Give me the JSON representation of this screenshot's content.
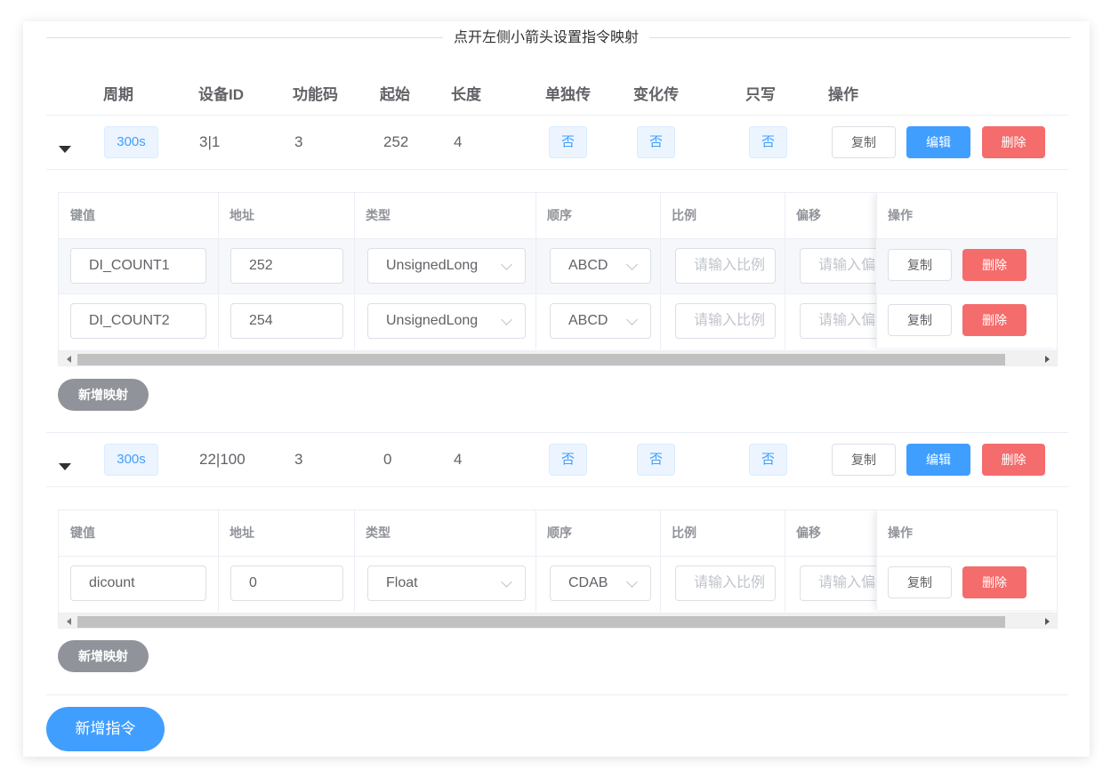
{
  "title": "点开左侧小箭头设置指令映射",
  "headers": [
    "周期",
    "设备ID",
    "功能码",
    "起始",
    "长度",
    "单独传",
    "变化传",
    "只写",
    "操作"
  ],
  "sub_headers": [
    "键值",
    "地址",
    "类型",
    "顺序",
    "比例",
    "偏移",
    "操作"
  ],
  "commands": [
    {
      "period": "300s",
      "device_id": "3|1",
      "func_code": "3",
      "start": "252",
      "length": "4",
      "single": "否",
      "change": "否",
      "write_only": "否",
      "copy": "复制",
      "edit": "编辑",
      "delete": "删除",
      "mappings": [
        {
          "key": "DI_COUNT1",
          "addr": "252",
          "type": "UnsignedLong",
          "order": "ABCD",
          "ratio_ph": "请输入比例",
          "offset_ph": "请输入偏移",
          "copy": "复制",
          "delete": "删除"
        },
        {
          "key": "DI_COUNT2",
          "addr": "254",
          "type": "UnsignedLong",
          "order": "ABCD",
          "ratio_ph": "请输入比例",
          "offset_ph": "请输入偏移",
          "copy": "复制",
          "delete": "删除"
        }
      ],
      "add_mapping": "新增映射"
    },
    {
      "period": "300s",
      "device_id": "22|100",
      "func_code": "3",
      "start": "0",
      "length": "4",
      "single": "否",
      "change": "否",
      "write_only": "否",
      "copy": "复制",
      "edit": "编辑",
      "delete": "删除",
      "mappings": [
        {
          "key": "dicount",
          "addr": "0",
          "type": "Float",
          "order": "CDAB",
          "ratio_ph": "请输入比例",
          "offset_ph": "请输入偏移",
          "copy": "复制",
          "delete": "删除"
        }
      ],
      "add_mapping": "新增映射"
    }
  ],
  "add_command": "新增指令",
  "colors": {
    "primary": "#409eff",
    "danger": "#f56c6c",
    "info": "#909399"
  }
}
